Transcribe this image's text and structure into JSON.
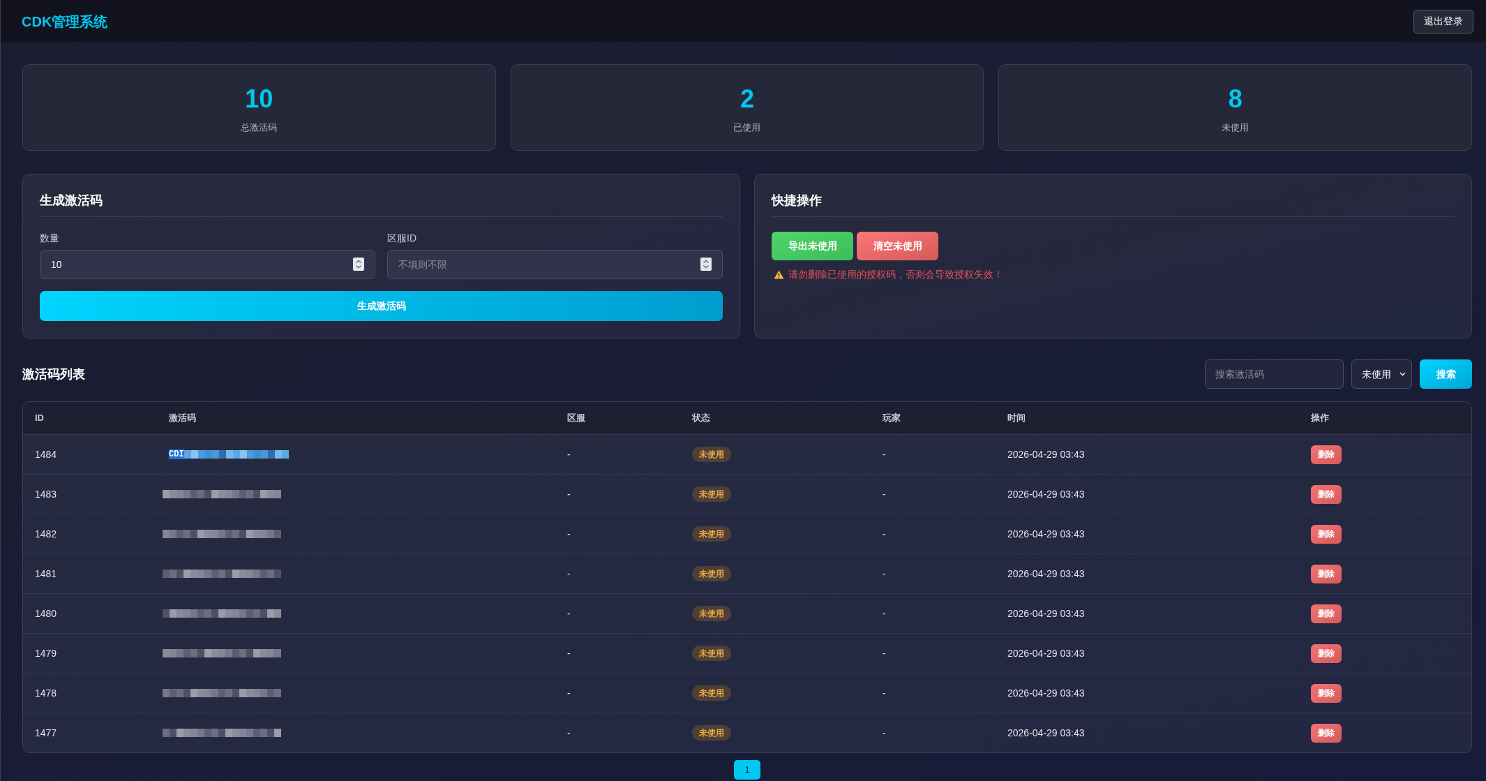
{
  "header": {
    "title": "CDK管理系统",
    "logout_button": "退出登录"
  },
  "stats": [
    {
      "value": "10",
      "label": "总激活码"
    },
    {
      "value": "2",
      "label": "已使用"
    },
    {
      "value": "8",
      "label": "未使用"
    }
  ],
  "generate_panel": {
    "title": "生成激活码",
    "fields": [
      {
        "label": "数量",
        "value": "10"
      },
      {
        "label": "区服ID",
        "placeholder": "不填则不限"
      }
    ],
    "submit_button": "生成激活码"
  },
  "quick_actions": {
    "title": "快捷操作",
    "buttons": [
      {
        "label": "导出未使用",
        "kind": "success"
      },
      {
        "label": "清空未使用",
        "kind": "danger"
      }
    ],
    "warning": "请勿删除已使用的授权码，否则会导致授权失效！"
  },
  "code_list": {
    "title": "激活码列表",
    "search": {
      "placeholder": "搜索激活码"
    },
    "status_filter": {
      "value": "未使用"
    },
    "search_button": "搜索",
    "table": {
      "columns": [
        "ID",
        "激活码",
        "区服",
        "状态",
        "玩家",
        "时间",
        "操作"
      ],
      "rows": [
        {
          "id": "1484",
          "code": "CDI",
          "code_highlighted": true,
          "server": "-",
          "status": "未使用",
          "player": "-",
          "time": "2026-04-29 03:43",
          "action": "删除"
        },
        {
          "id": "1483",
          "code_highlighted": false,
          "server": "-",
          "status": "未使用",
          "player": "-",
          "time": "2026-04-29 03:43",
          "action": "删除"
        },
        {
          "id": "1482",
          "code_highlighted": false,
          "server": "-",
          "status": "未使用",
          "player": "-",
          "time": "2026-04-29 03:43",
          "action": "删除"
        },
        {
          "id": "1481",
          "code_highlighted": false,
          "server": "-",
          "status": "未使用",
          "player": "-",
          "time": "2026-04-29 03:43",
          "action": "删除"
        },
        {
          "id": "1480",
          "code_highlighted": false,
          "server": "-",
          "status": "未使用",
          "player": "-",
          "time": "2026-04-29 03:43",
          "action": "删除"
        },
        {
          "id": "1479",
          "code_highlighted": false,
          "server": "-",
          "status": "未使用",
          "player": "-",
          "time": "2026-04-29 03:43",
          "action": "删除"
        },
        {
          "id": "1478",
          "code_highlighted": false,
          "server": "-",
          "status": "未使用",
          "player": "-",
          "time": "2026-04-29 03:43",
          "action": "删除"
        },
        {
          "id": "1477",
          "code_highlighted": false,
          "server": "-",
          "status": "未使用",
          "player": "-",
          "time": "2026-04-29 03:43",
          "action": "删除"
        }
      ]
    }
  },
  "pagination": {
    "pages": [
      {
        "label": "1",
        "selected": true
      }
    ]
  }
}
